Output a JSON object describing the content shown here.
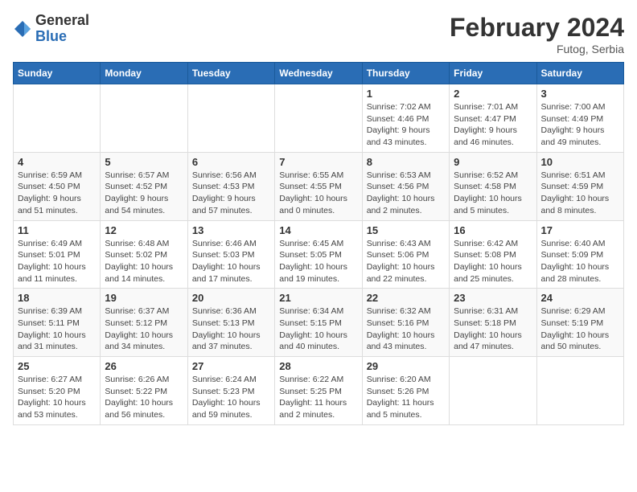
{
  "logo": {
    "general": "General",
    "blue": "Blue"
  },
  "header": {
    "month": "February 2024",
    "location": "Futog, Serbia"
  },
  "weekdays": [
    "Sunday",
    "Monday",
    "Tuesday",
    "Wednesday",
    "Thursday",
    "Friday",
    "Saturday"
  ],
  "weeks": [
    [
      {
        "day": "",
        "info": ""
      },
      {
        "day": "",
        "info": ""
      },
      {
        "day": "",
        "info": ""
      },
      {
        "day": "",
        "info": ""
      },
      {
        "day": "1",
        "info": "Sunrise: 7:02 AM\nSunset: 4:46 PM\nDaylight: 9 hours\nand 43 minutes."
      },
      {
        "day": "2",
        "info": "Sunrise: 7:01 AM\nSunset: 4:47 PM\nDaylight: 9 hours\nand 46 minutes."
      },
      {
        "day": "3",
        "info": "Sunrise: 7:00 AM\nSunset: 4:49 PM\nDaylight: 9 hours\nand 49 minutes."
      }
    ],
    [
      {
        "day": "4",
        "info": "Sunrise: 6:59 AM\nSunset: 4:50 PM\nDaylight: 9 hours\nand 51 minutes."
      },
      {
        "day": "5",
        "info": "Sunrise: 6:57 AM\nSunset: 4:52 PM\nDaylight: 9 hours\nand 54 minutes."
      },
      {
        "day": "6",
        "info": "Sunrise: 6:56 AM\nSunset: 4:53 PM\nDaylight: 9 hours\nand 57 minutes."
      },
      {
        "day": "7",
        "info": "Sunrise: 6:55 AM\nSunset: 4:55 PM\nDaylight: 10 hours\nand 0 minutes."
      },
      {
        "day": "8",
        "info": "Sunrise: 6:53 AM\nSunset: 4:56 PM\nDaylight: 10 hours\nand 2 minutes."
      },
      {
        "day": "9",
        "info": "Sunrise: 6:52 AM\nSunset: 4:58 PM\nDaylight: 10 hours\nand 5 minutes."
      },
      {
        "day": "10",
        "info": "Sunrise: 6:51 AM\nSunset: 4:59 PM\nDaylight: 10 hours\nand 8 minutes."
      }
    ],
    [
      {
        "day": "11",
        "info": "Sunrise: 6:49 AM\nSunset: 5:01 PM\nDaylight: 10 hours\nand 11 minutes."
      },
      {
        "day": "12",
        "info": "Sunrise: 6:48 AM\nSunset: 5:02 PM\nDaylight: 10 hours\nand 14 minutes."
      },
      {
        "day": "13",
        "info": "Sunrise: 6:46 AM\nSunset: 5:03 PM\nDaylight: 10 hours\nand 17 minutes."
      },
      {
        "day": "14",
        "info": "Sunrise: 6:45 AM\nSunset: 5:05 PM\nDaylight: 10 hours\nand 19 minutes."
      },
      {
        "day": "15",
        "info": "Sunrise: 6:43 AM\nSunset: 5:06 PM\nDaylight: 10 hours\nand 22 minutes."
      },
      {
        "day": "16",
        "info": "Sunrise: 6:42 AM\nSunset: 5:08 PM\nDaylight: 10 hours\nand 25 minutes."
      },
      {
        "day": "17",
        "info": "Sunrise: 6:40 AM\nSunset: 5:09 PM\nDaylight: 10 hours\nand 28 minutes."
      }
    ],
    [
      {
        "day": "18",
        "info": "Sunrise: 6:39 AM\nSunset: 5:11 PM\nDaylight: 10 hours\nand 31 minutes."
      },
      {
        "day": "19",
        "info": "Sunrise: 6:37 AM\nSunset: 5:12 PM\nDaylight: 10 hours\nand 34 minutes."
      },
      {
        "day": "20",
        "info": "Sunrise: 6:36 AM\nSunset: 5:13 PM\nDaylight: 10 hours\nand 37 minutes."
      },
      {
        "day": "21",
        "info": "Sunrise: 6:34 AM\nSunset: 5:15 PM\nDaylight: 10 hours\nand 40 minutes."
      },
      {
        "day": "22",
        "info": "Sunrise: 6:32 AM\nSunset: 5:16 PM\nDaylight: 10 hours\nand 43 minutes."
      },
      {
        "day": "23",
        "info": "Sunrise: 6:31 AM\nSunset: 5:18 PM\nDaylight: 10 hours\nand 47 minutes."
      },
      {
        "day": "24",
        "info": "Sunrise: 6:29 AM\nSunset: 5:19 PM\nDaylight: 10 hours\nand 50 minutes."
      }
    ],
    [
      {
        "day": "25",
        "info": "Sunrise: 6:27 AM\nSunset: 5:20 PM\nDaylight: 10 hours\nand 53 minutes."
      },
      {
        "day": "26",
        "info": "Sunrise: 6:26 AM\nSunset: 5:22 PM\nDaylight: 10 hours\nand 56 minutes."
      },
      {
        "day": "27",
        "info": "Sunrise: 6:24 AM\nSunset: 5:23 PM\nDaylight: 10 hours\nand 59 minutes."
      },
      {
        "day": "28",
        "info": "Sunrise: 6:22 AM\nSunset: 5:25 PM\nDaylight: 11 hours\nand 2 minutes."
      },
      {
        "day": "29",
        "info": "Sunrise: 6:20 AM\nSunset: 5:26 PM\nDaylight: 11 hours\nand 5 minutes."
      },
      {
        "day": "",
        "info": ""
      },
      {
        "day": "",
        "info": ""
      }
    ]
  ]
}
